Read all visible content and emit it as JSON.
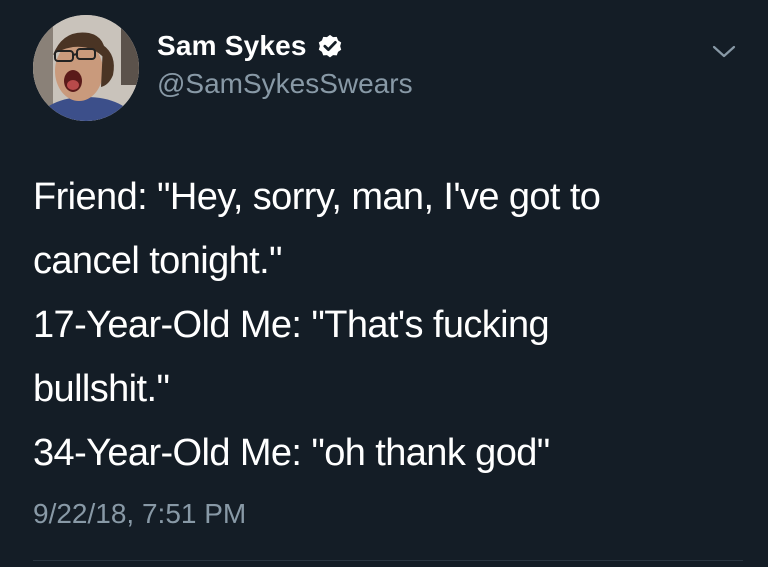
{
  "tweet": {
    "author": {
      "display_name": "Sam Sykes",
      "handle": "@SamSykesSwears",
      "verified": true
    },
    "body_lines": [
      "Friend: \"Hey, sorry, man, I've got to",
      "cancel tonight.\"",
      "17-Year-Old Me: \"That's fucking",
      "bullshit.\"",
      "34-Year-Old Me: \"oh thank god\""
    ],
    "timestamp": "9/22/18, 7:51 PM"
  },
  "icons": {
    "verified": "verified-badge-icon",
    "menu": "chevron-down-icon"
  },
  "colors": {
    "background": "#141d26",
    "primary_text": "#ffffff",
    "secondary_text": "#8899a6",
    "verified_badge": "#ffffff"
  }
}
